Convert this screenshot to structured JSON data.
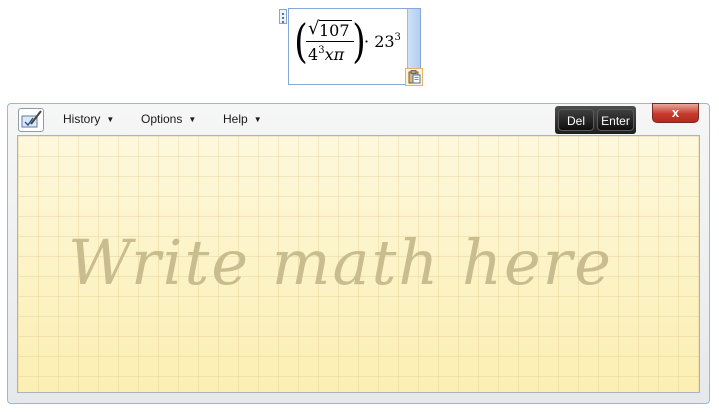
{
  "equation": {
    "radicand": "107",
    "den_base": "4",
    "den_exp": "3",
    "den_vars": "xπ",
    "operator": "·",
    "base": "23",
    "exponent": "3"
  },
  "toolbar": {
    "history_label": "History",
    "options_label": "Options",
    "help_label": "Help",
    "del_label": "Del",
    "enter_label": "Enter",
    "close_glyph": "x"
  },
  "writing_area": {
    "placeholder": "Write math here"
  },
  "icons": {
    "app": "math-input-panel-icon",
    "paste": "clipboard-paste-icon",
    "handle": "drag-handle-icon",
    "dropdown": "chevron-down-icon"
  },
  "colors": {
    "writing_bg": "#fdf4c4",
    "placeholder_text": "#c9bd90",
    "close_button": "#c8392b",
    "action_buttons": "#1e1e1e"
  }
}
